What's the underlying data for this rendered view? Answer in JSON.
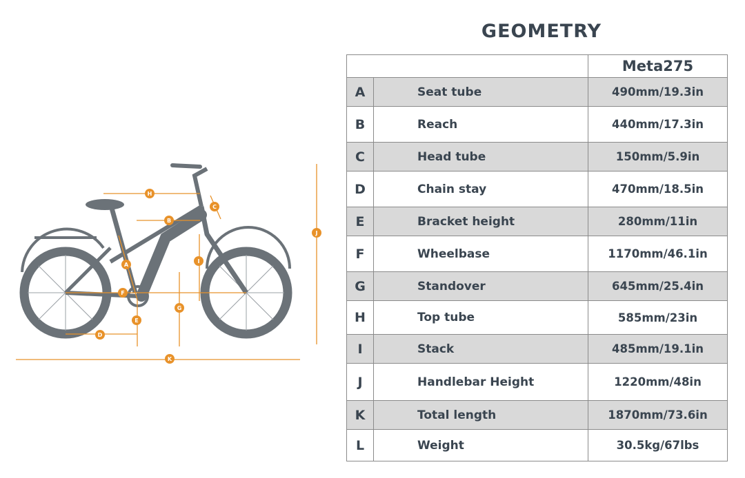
{
  "title": "GEOMETRY",
  "table": {
    "model": "Meta275",
    "rows": [
      {
        "letter": "A",
        "name": "Seat tube",
        "value": "490mm/19.3in"
      },
      {
        "letter": "B",
        "name": "Reach",
        "value": "440mm/17.3in"
      },
      {
        "letter": "C",
        "name": "Head tube",
        "value": "150mm/5.9in"
      },
      {
        "letter": "D",
        "name": "Chain stay",
        "value": "470mm/18.5in"
      },
      {
        "letter": "E",
        "name": "Bracket height",
        "value": "280mm/11in"
      },
      {
        "letter": "F",
        "name": "Wheelbase",
        "value": "1170mm/46.1in"
      },
      {
        "letter": "G",
        "name": "Standover",
        "value": "645mm/25.4in"
      },
      {
        "letter": "H",
        "name": "Top tube",
        "value": "585mm/23in"
      },
      {
        "letter": "I",
        "name": "Stack",
        "value": "485mm/19.1in"
      },
      {
        "letter": "J",
        "name": "Handlebar Height",
        "value": "1220mm/48in"
      },
      {
        "letter": "K",
        "name": "Total length",
        "value": "1870mm/73.6in"
      },
      {
        "letter": "L",
        "name": "Weight",
        "value": "30.5kg/67lbs"
      }
    ]
  },
  "diagram": {
    "markers": [
      "A",
      "B",
      "C",
      "D",
      "E",
      "F",
      "G",
      "H",
      "I",
      "J",
      "K"
    ],
    "colors": {
      "accent": "#e8922a",
      "bike": "#6b7278",
      "text": "#3a4550",
      "row_shade": "#d9d9d9"
    }
  }
}
